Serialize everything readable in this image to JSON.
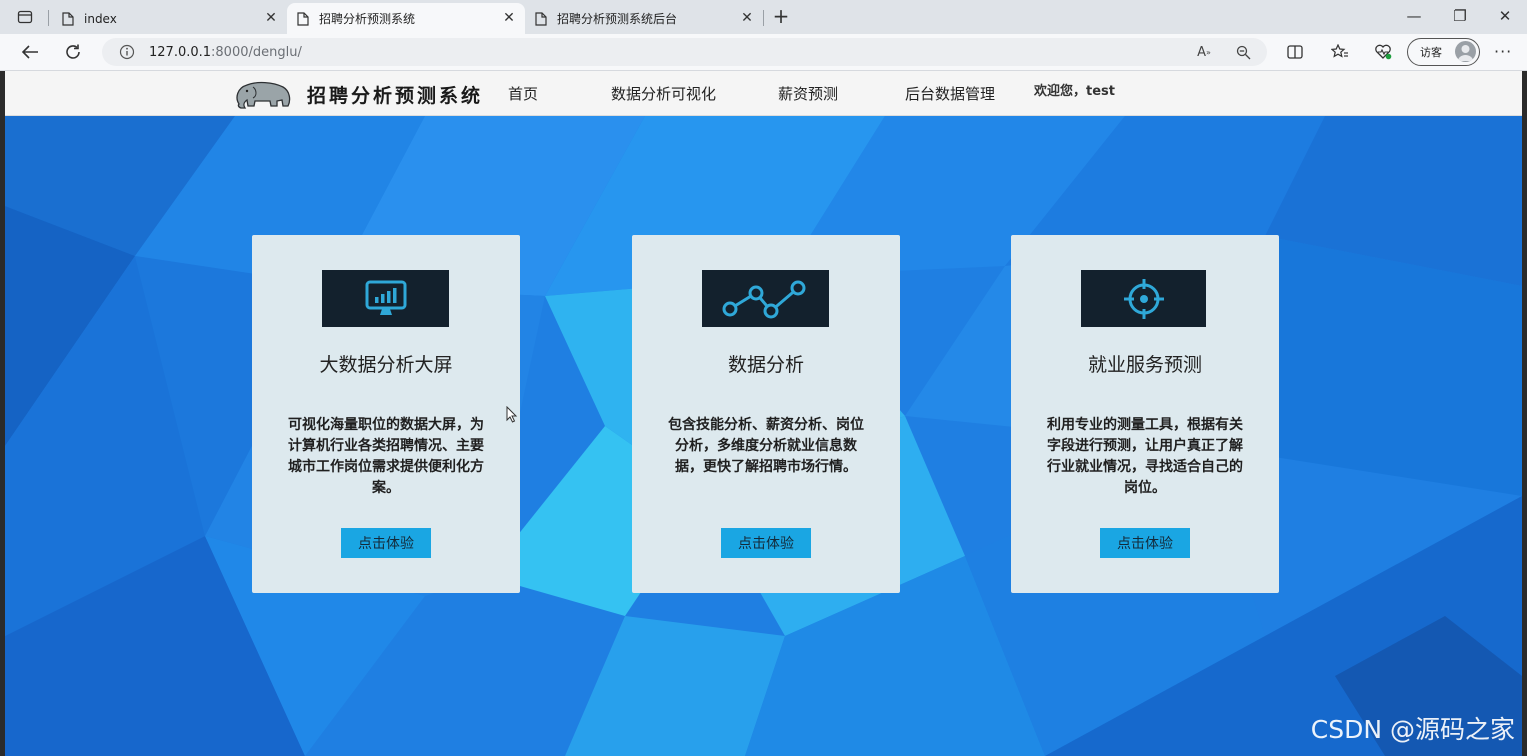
{
  "browser": {
    "tabs": [
      {
        "title": "index",
        "active": false
      },
      {
        "title": "招聘分析预测系统",
        "active": true
      },
      {
        "title": "招聘分析预测系统后台",
        "active": false
      }
    ],
    "url_host": "127.0.0.1",
    "url_rest": ":8000/denglu/",
    "guest_label": "访客"
  },
  "site": {
    "title": "招聘分析预测系统",
    "nav": [
      "首页",
      "数据分析可视化",
      "薪资预测",
      "后台数据管理"
    ],
    "welcome": "欢迎您，test"
  },
  "cards": [
    {
      "icon": "monitor-chart-icon",
      "title": "大数据分析大屏",
      "desc": "可视化海量职位的数据大屏，为计算机行业各类招聘情况、主要城市工作岗位需求提供便利化方案。",
      "button": "点击体验"
    },
    {
      "icon": "line-chart-icon",
      "title": "数据分析",
      "desc": "包含技能分析、薪资分析、岗位分析，多维度分析就业信息数据，更快了解招聘市场行情。",
      "button": "点击体验"
    },
    {
      "icon": "crosshair-target-icon",
      "title": "就业服务预测",
      "desc": "利用专业的测量工具，根据有关字段进行预测，让用户真正了解行业就业情况，寻找适合自己的岗位。",
      "button": "点击体验"
    }
  ],
  "watermark": "CSDN @源码之家",
  "colors": {
    "hero_blue": "#1f7fe2",
    "card_bg": "#dde9ee",
    "icon_box": "#13212d",
    "icon_stroke": "#2fa8d8",
    "button_bg": "#1aa6e3"
  }
}
